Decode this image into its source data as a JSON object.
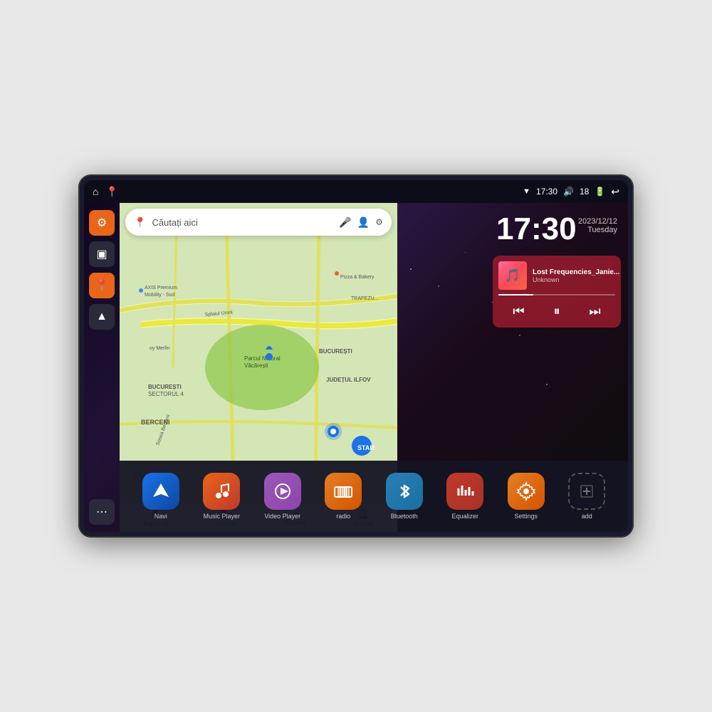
{
  "device": {
    "status_bar": {
      "time": "17:30",
      "battery": "18",
      "wifi_icon": "▼",
      "volume_icon": "🔊",
      "battery_icon": "🔋",
      "back_icon": "↩",
      "home_icon": "⌂",
      "maps_icon": "📍"
    },
    "clock": {
      "time": "17:30",
      "date": "2023/12/12",
      "day": "Tuesday"
    },
    "music": {
      "title": "Lost Frequencies_Janie...",
      "artist": "Unknown",
      "album_emoji": "🎵"
    },
    "map": {
      "search_placeholder": "Căutați aici",
      "bottom_items": [
        {
          "label": "Explorați",
          "icon": "📍",
          "active": true
        },
        {
          "label": "Salvate",
          "icon": "🔖",
          "active": false
        },
        {
          "label": "Trimiteți",
          "icon": "↗",
          "active": false
        },
        {
          "label": "Noutăți",
          "icon": "🔔",
          "active": false
        }
      ]
    },
    "sidebar": {
      "items": [
        {
          "icon": "⚙",
          "style": "orange"
        },
        {
          "icon": "▣",
          "style": "dark"
        },
        {
          "icon": "📍",
          "style": "orange"
        },
        {
          "icon": "▲",
          "style": "dark"
        }
      ],
      "bottom": {
        "icon": "⋯",
        "style": "dark"
      }
    },
    "apps": [
      {
        "id": "navi",
        "label": "Navi",
        "icon": "▲",
        "style": "navi"
      },
      {
        "id": "music-player",
        "label": "Music Player",
        "icon": "♪",
        "style": "music"
      },
      {
        "id": "video-player",
        "label": "Video Player",
        "icon": "▶",
        "style": "video"
      },
      {
        "id": "radio",
        "label": "radio",
        "icon": "📻",
        "style": "radio"
      },
      {
        "id": "bluetooth",
        "label": "Bluetooth",
        "icon": "₿",
        "style": "bt"
      },
      {
        "id": "equalizer",
        "label": "Equalizer",
        "icon": "≡",
        "style": "eq"
      },
      {
        "id": "settings",
        "label": "Settings",
        "icon": "⚙",
        "style": "settings"
      },
      {
        "id": "add",
        "label": "add",
        "icon": "+",
        "style": "add"
      }
    ]
  }
}
